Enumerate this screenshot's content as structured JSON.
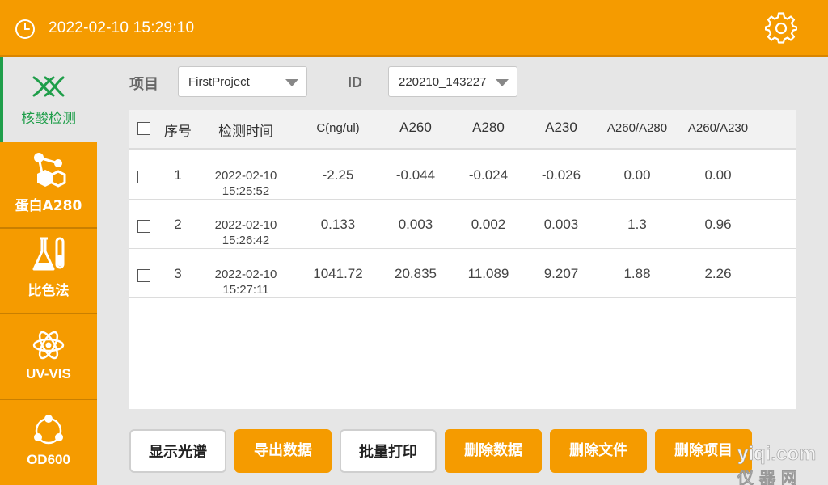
{
  "header": {
    "datetime": "2022-02-10 15:29:10",
    "clock_icon": "clock-icon",
    "settings_icon": "gear-icon",
    "bg_color": "#f59b00"
  },
  "sidebar": {
    "active_color": "#1f9e4a",
    "items": [
      {
        "label": "核酸检测",
        "icon": "dna-icon",
        "active": true
      },
      {
        "label": "蛋白A280",
        "icon": "molecule-icon",
        "active": false
      },
      {
        "label": "比色法",
        "icon": "flask-icon",
        "active": false
      },
      {
        "label": "UV-VIS",
        "icon": "atom-icon",
        "active": false
      },
      {
        "label": "OD600",
        "icon": "cells-icon",
        "active": false
      }
    ]
  },
  "filters": {
    "project_label": "项目",
    "project_value": "FirstProject",
    "id_label": "ID",
    "id_value": "220210_143227"
  },
  "table": {
    "headers": [
      "序号",
      "检测时间",
      "C(ng/ul)",
      "A260",
      "A280",
      "A230",
      "A260/A280",
      "A260/A230"
    ],
    "rows": [
      {
        "no": "1",
        "date": "2022-02-10",
        "time": "15:25:52",
        "conc": "-2.25",
        "a260": "-0.044",
        "a280": "-0.024",
        "a230": "-0.026",
        "r1": "0.00",
        "r2": "0.00"
      },
      {
        "no": "2",
        "date": "2022-02-10",
        "time": "15:26:42",
        "conc": "0.133",
        "a260": "0.003",
        "a280": "0.002",
        "a230": "0.003",
        "r1": "1.3",
        "r2": "0.96"
      },
      {
        "no": "3",
        "date": "2022-02-10",
        "time": "15:27:11",
        "conc": "1041.72",
        "a260": "20.835",
        "a280": "11.089",
        "a230": "9.207",
        "r1": "1.88",
        "r2": "2.26"
      }
    ]
  },
  "buttons": {
    "show_spectrum": "显示光谱",
    "export_data": "导出数据",
    "batch_print": "批量打印",
    "delete_data": "删除数据",
    "delete_file": "删除文件",
    "delete_project": "删除项目"
  },
  "watermark": {
    "line1": "yiqi.com",
    "line2": "仪 器 网"
  }
}
